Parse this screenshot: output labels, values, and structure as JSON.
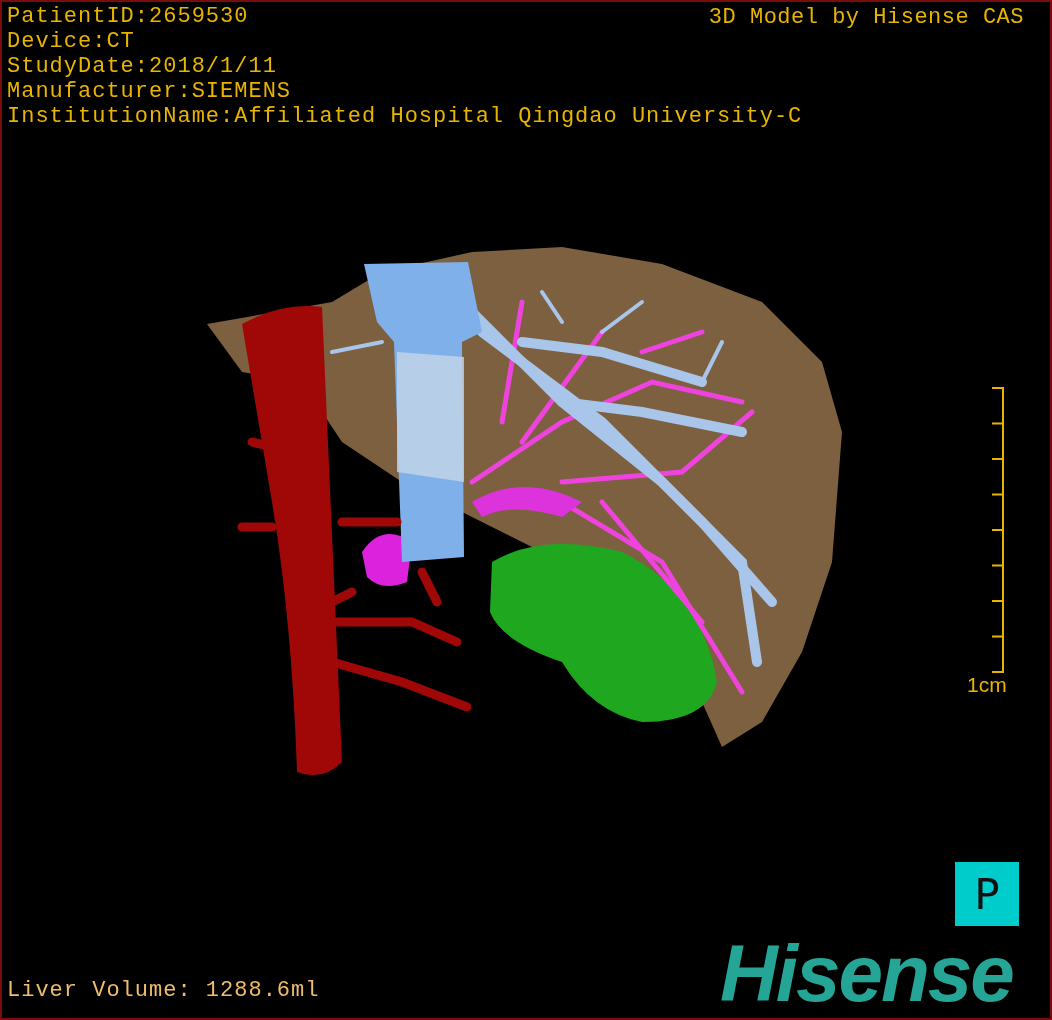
{
  "study_info": {
    "lines": [
      "PatientID:2659530",
      "Device:CT",
      "StudyDate:2018/1/11",
      "Manufacturer:SIEMENS",
      "InstitutionName:Affiliated Hospital Qingdao University-C"
    ]
  },
  "title": "3D Model by Hisense CAS",
  "scale_bar": {
    "label": "1cm"
  },
  "orientation_marker": {
    "label": "P"
  },
  "logo": {
    "text": "Hisense"
  },
  "measurement": {
    "label": "Liver Volume: 1288.6ml"
  }
}
